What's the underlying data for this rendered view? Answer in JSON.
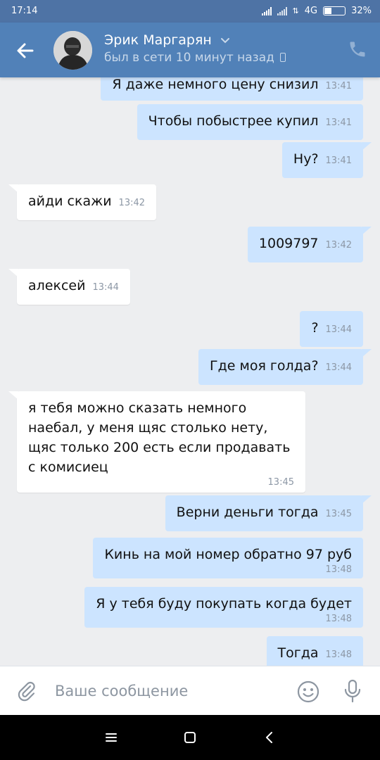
{
  "status_bar": {
    "time": "17:14",
    "network": "4G",
    "battery": "32%",
    "battery_level": 0.32
  },
  "header": {
    "contact_name": "Эрик Маргарян",
    "last_seen": "был в сети 10 минут назад",
    "back_icon": "arrow-left-icon",
    "call_icon": "phone-icon"
  },
  "messages": [
    {
      "dir": "out",
      "text": "Я даже немного цену снизил",
      "time": "13:41"
    },
    {
      "dir": "out",
      "text": "Чтобы побыстрее купил",
      "time": "13:41"
    },
    {
      "dir": "out",
      "text": "Ну?",
      "time": "13:41"
    },
    {
      "dir": "in",
      "text": "айди скажи",
      "time": "13:42"
    },
    {
      "dir": "out",
      "text": "1009797",
      "time": "13:42"
    },
    {
      "dir": "in",
      "text": "алексей",
      "time": "13:44"
    },
    {
      "dir": "out",
      "text": "?",
      "time": "13:44"
    },
    {
      "dir": "out",
      "text": "Где моя голда?",
      "time": "13:44"
    },
    {
      "dir": "in",
      "text": "я тебя можно сказать немного наебал, у меня щяс столько нету, щяс только 200 есть если продавать с комисиец",
      "time": "13:45"
    },
    {
      "dir": "out",
      "text": "Верни деньги тогда",
      "time": "13:45"
    },
    {
      "dir": "out",
      "text": "Кинь на мой номер обратно 97 руб",
      "time": "13:48"
    },
    {
      "dir": "out",
      "text": "Я у тебя буду покупать когда будет",
      "time": "13:48"
    },
    {
      "dir": "out",
      "text": "Тогда",
      "time": "13:48"
    }
  ],
  "composer": {
    "placeholder": "Ваше сообщение",
    "attach_icon": "paperclip-icon",
    "emoji_icon": "smiley-icon",
    "mic_icon": "microphone-icon"
  },
  "nav_bar": {
    "menu_icon": "menu-icon",
    "home_icon": "home-icon",
    "back_icon": "back-icon"
  },
  "colors": {
    "header": "#5181b8",
    "status_bar": "#4e73a5",
    "outgoing_bubble": "#cce4ff",
    "incoming_bubble": "#ffffff",
    "chat_background": "#edeef0"
  }
}
